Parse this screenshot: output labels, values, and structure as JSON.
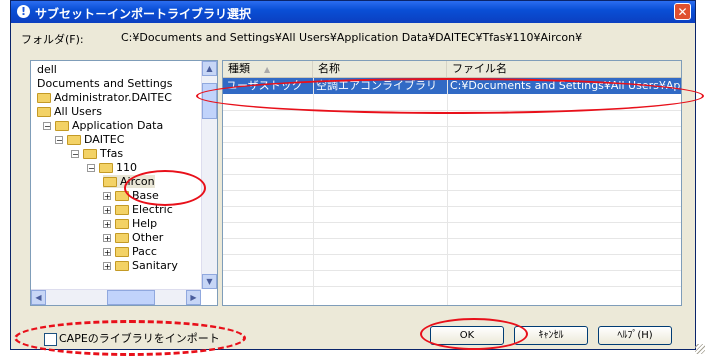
{
  "window": {
    "title": "サブセット－インポートライブラリ選択",
    "close": "✕"
  },
  "folder": {
    "label": "フォルダ(F):",
    "path": "C:¥Documents and Settings¥All Users¥Application Data¥DAITEC¥Tfas¥110¥Aircon¥"
  },
  "tree": {
    "items": [
      {
        "label": "dell"
      },
      {
        "label": "Documents and Settings"
      },
      {
        "label": "Administrator.DAITEC"
      },
      {
        "label": "All Users"
      },
      {
        "label": "Application Data"
      },
      {
        "label": "DAITEC"
      },
      {
        "label": "Tfas"
      },
      {
        "label": "110"
      },
      {
        "label": "Aircon"
      },
      {
        "label": "Base"
      },
      {
        "label": "Electric"
      },
      {
        "label": "Help"
      },
      {
        "label": "Other"
      },
      {
        "label": "Pacc"
      },
      {
        "label": "Sanitary"
      }
    ]
  },
  "list": {
    "columns": [
      "種類",
      "名称",
      "ファイル名"
    ],
    "rows": [
      {
        "type": "ユーザストック",
        "name": "空調エアコンライブラリ",
        "file": "C:¥Documents and Settings¥All Users¥Ap"
      }
    ]
  },
  "checkbox": {
    "label": "CAPEのライブラリをインポート"
  },
  "buttons": {
    "ok": "OK",
    "cancel": "ｷｬﾝｾﾙ",
    "help": "ﾍﾙﾌﾟ(H)"
  },
  "colors": {
    "selection": "#316ac5",
    "annotation": "#e8101a",
    "titlebar": "#0a4fd6"
  }
}
